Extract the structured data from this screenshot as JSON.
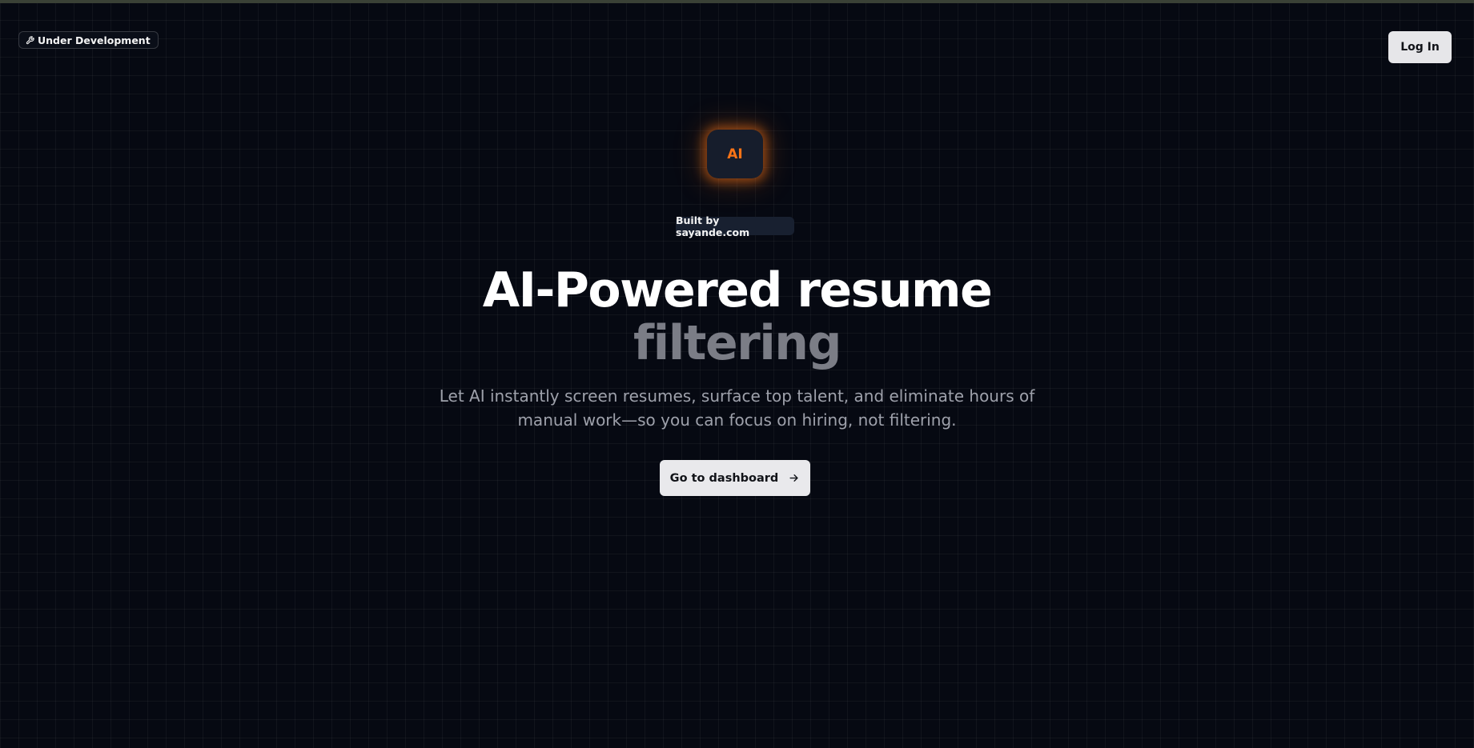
{
  "header": {
    "status_badge": {
      "icon": "wrench-icon",
      "label": "Under Development"
    },
    "login_label": "Log In"
  },
  "hero": {
    "logo_text": "AI",
    "built_by_label": "Built by sayande.com",
    "headline_line1": "AI-Powered resume",
    "headline_line2": "filtering",
    "subtitle_line1": "Let AI instantly screen resumes, surface top talent, and eliminate hours of",
    "subtitle_line2": "manual work—so you can focus on hiring, not filtering.",
    "cta": {
      "label": "Go to dashboard",
      "icon": "arrow-right-icon"
    }
  },
  "colors": {
    "background": "#060912",
    "accent": "#f97316",
    "headline_primary": "#ffffff",
    "headline_secondary": "#7b7d86",
    "button_bg": "#e9e9ec"
  }
}
